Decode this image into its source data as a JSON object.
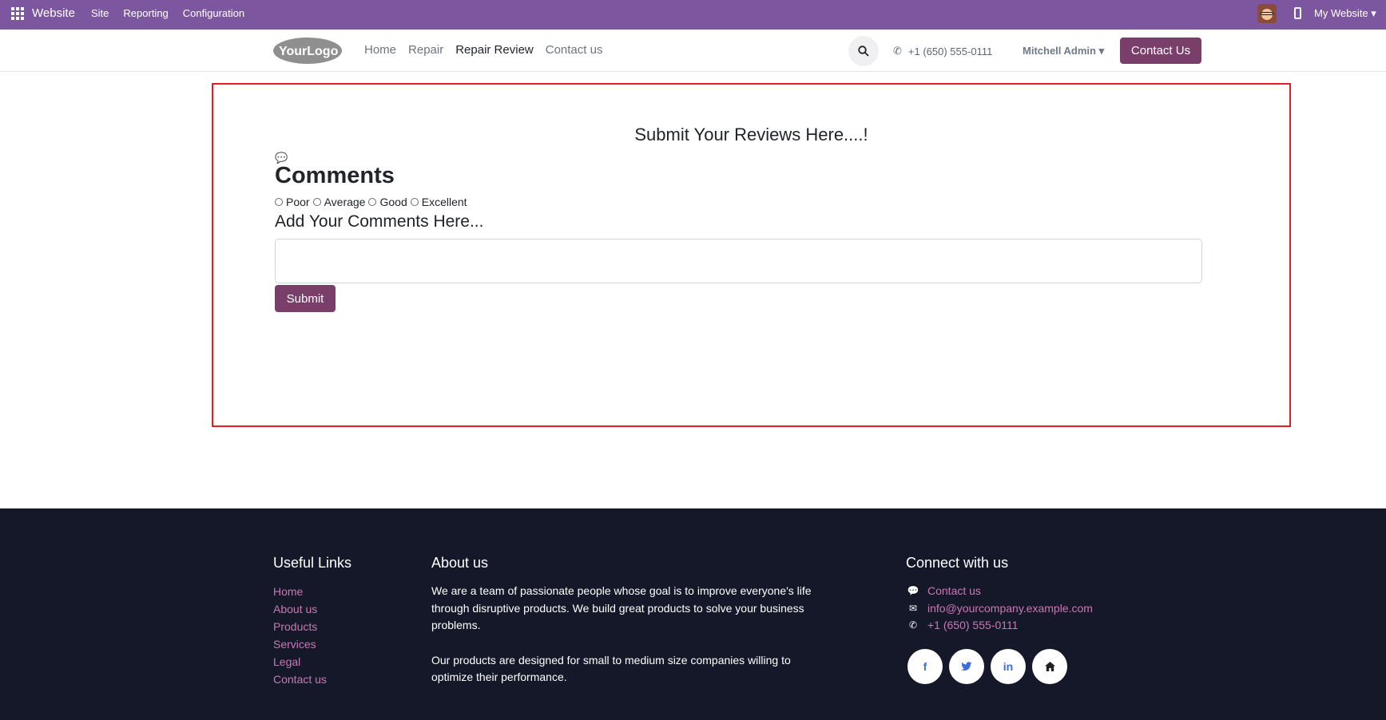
{
  "adminbar": {
    "brand": "Website",
    "menu": [
      "Site",
      "Reporting",
      "Configuration"
    ],
    "my_website": "My Website"
  },
  "header": {
    "logo_text": "YourLogo",
    "nav": [
      "Home",
      "Repair",
      "Repair Review",
      "Contact us"
    ],
    "active_nav": "Repair Review",
    "phone": "+1 (650) 555-0111",
    "user": "Mitchell Admin",
    "contact_button": "Contact Us"
  },
  "review": {
    "title": "Submit Your Reviews Here....!",
    "heading": "Comments",
    "ratings": [
      "Poor",
      "Average",
      "Good",
      "Excellent"
    ],
    "add_label": "Add Your Comments Here...",
    "textarea_value": "",
    "submit_label": "Submit"
  },
  "footer": {
    "useful_links_heading": "Useful Links",
    "links": [
      "Home",
      "About us",
      "Products",
      "Services",
      "Legal",
      "Contact us"
    ],
    "about_heading": "About us",
    "about_p1": "We are a team of passionate people whose goal is to improve everyone's life through disruptive products. We build great products to solve your business problems.",
    "about_p2": "Our products are designed for small to medium size companies willing to optimize their performance.",
    "connect_heading": "Connect with us",
    "contact_link": "Contact us",
    "email": "info@yourcompany.example.com",
    "phone": "+1 (650) 555-0111",
    "socials": [
      "facebook-icon",
      "twitter-icon",
      "linkedin-icon",
      "home-icon"
    ]
  },
  "colors": {
    "adminbar": "#7c57a0",
    "primary_button": "#7a3e6a",
    "highlight_border": "#e51c23",
    "footer_bg": "#141828",
    "footer_link": "#c978b5"
  }
}
